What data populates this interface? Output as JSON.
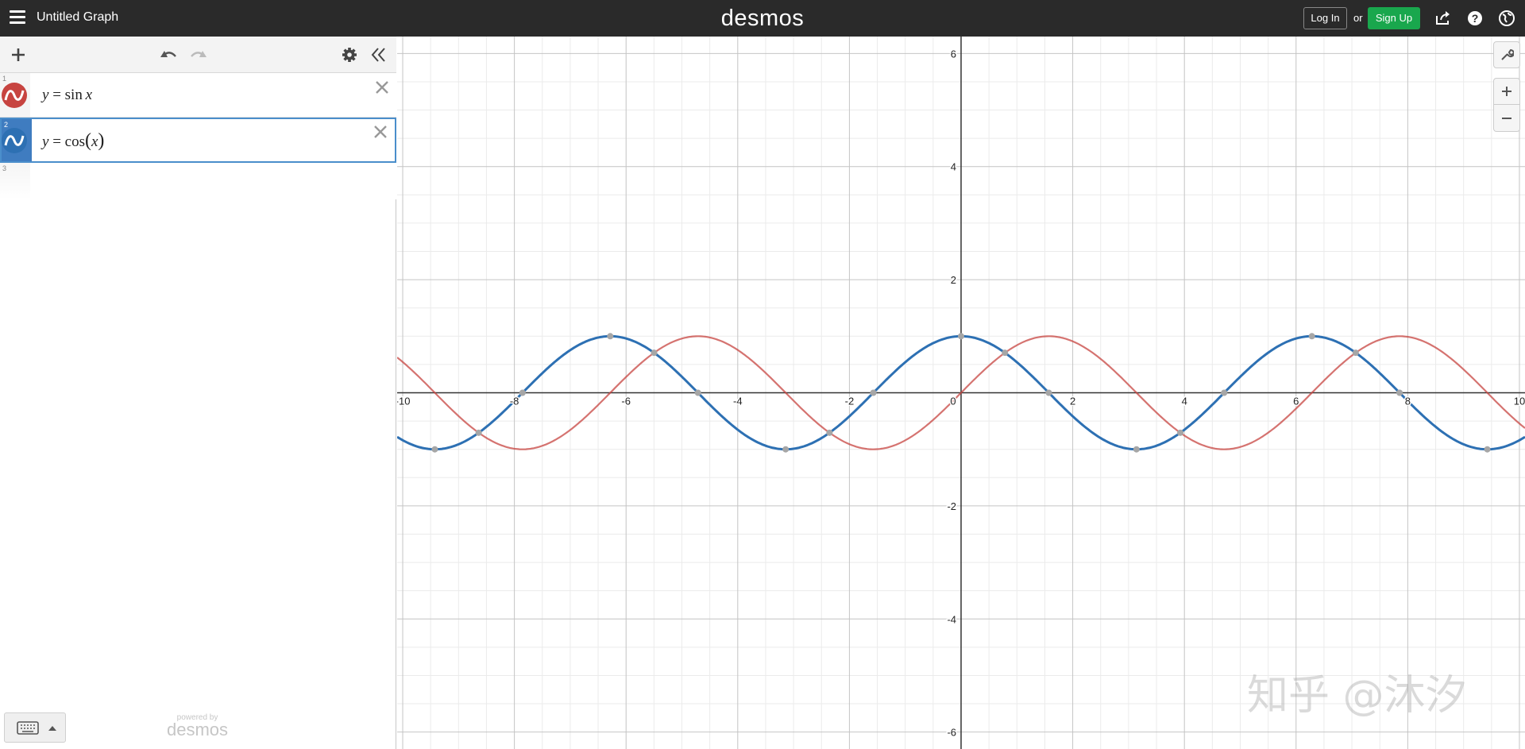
{
  "header": {
    "title": "Untitled Graph",
    "brand": "desmos",
    "login_label": "Log In",
    "or_label": "or",
    "signup_label": "Sign Up"
  },
  "toolbar": {
    "icons": [
      "plus-icon",
      "undo-icon",
      "redo-icon",
      "gear-icon",
      "collapse-icon"
    ]
  },
  "expressions": [
    {
      "index": "1",
      "lhs": "y",
      "eq": " = ",
      "func": "sin",
      "arg": "x",
      "paren": false,
      "color": "#c74440"
    },
    {
      "index": "2",
      "lhs": "y",
      "eq": " = ",
      "func": "cos",
      "arg": "x",
      "paren": true,
      "color": "#2d70b3"
    },
    {
      "index": "3"
    }
  ],
  "footer": {
    "powered_by": "powered by",
    "powered_brand": "desmos"
  },
  "graph": {
    "x_ticks": [
      "-10",
      "-8",
      "-6",
      "-4",
      "-2",
      "0",
      "2",
      "4",
      "6",
      "8",
      "10"
    ],
    "y_ticks": [
      "6",
      "4",
      "2",
      "-2",
      "-4",
      "-6"
    ],
    "xlim": [
      -10.1,
      10.1
    ],
    "ylim": [
      -6.3,
      6.3
    ]
  },
  "chart_data": {
    "type": "line",
    "series": [
      {
        "name": "y = sin x",
        "color": "#c74440",
        "function": "sin"
      },
      {
        "name": "y = cos(x)",
        "color": "#2d70b3",
        "function": "cos"
      }
    ],
    "xlim": [
      -10.1,
      10.1
    ],
    "ylim": [
      -6.3,
      6.3
    ],
    "grid": true
  },
  "watermark": "知乎 @沐汐"
}
